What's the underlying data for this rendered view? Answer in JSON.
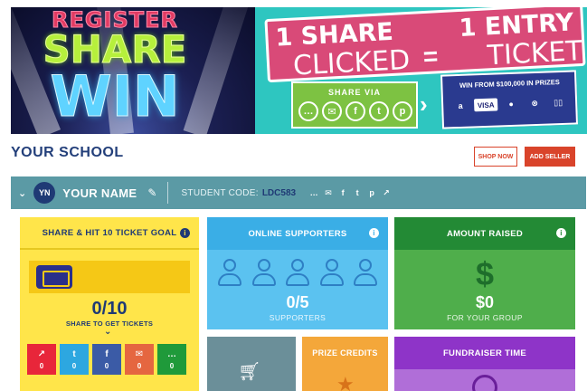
{
  "banner": {
    "register": "REGISTER",
    "share": "SHARE",
    "win": "WIN",
    "ticket_line1_left": "1 SHARE",
    "ticket_line1_right": "1 ENTRY",
    "ticket_line2_left": "CLICKED",
    "ticket_line2_right": "TICKET",
    "equals": "=",
    "share_via": "SHARE VIA",
    "share_via_icons": [
      "chat-icon",
      "email-icon",
      "facebook-icon",
      "twitter-icon",
      "pinterest-icon"
    ],
    "prizes_label": "WIN FROM $100,000 IN PRIZES",
    "prize_icons": [
      "amazon-icon",
      "visa-icon",
      "apple-icon",
      "xbox-icon",
      "nintendo-switch-icon"
    ],
    "visa_text": "VISA",
    "amazon_text": "a"
  },
  "school": {
    "title": "YOUR SCHOOL",
    "shop_now": "SHOP NOW",
    "add_seller": "ADD SELLER"
  },
  "student": {
    "initials": "YN",
    "name": "YOUR NAME",
    "code_label": "STUDENT CODE:",
    "code": "LDC583",
    "share_icons": [
      "chat-icon",
      "email-icon",
      "facebook-icon",
      "twitter-icon",
      "pinterest-icon",
      "external-link-icon"
    ]
  },
  "cards": {
    "goal": {
      "title": "SHARE & HIT 10 TICKET GOAL",
      "count": "0/10",
      "sub": "SHARE TO GET TICKETS",
      "buttons": [
        {
          "icon": "external-link-icon",
          "glyph": "↗",
          "count": "0",
          "color": "#e8263a"
        },
        {
          "icon": "twitter-icon",
          "glyph": "t",
          "count": "0",
          "color": "#2da7e0"
        },
        {
          "icon": "facebook-icon",
          "glyph": "f",
          "count": "0",
          "color": "#3b5ba6"
        },
        {
          "icon": "email-icon",
          "glyph": "✉",
          "count": "0",
          "color": "#e56640"
        },
        {
          "icon": "chat-icon",
          "glyph": "…",
          "count": "0",
          "color": "#1f9a3a"
        }
      ]
    },
    "online": {
      "title": "ONLINE SUPPORTERS",
      "count": "0/5",
      "sub": "SUPPORTERS"
    },
    "amount": {
      "title": "AMOUNT RAISED",
      "value": "$0",
      "sub": "FOR YOUR GROUP"
    },
    "prize": {
      "title": "PRIZE CREDITS"
    },
    "time": {
      "title": "FUNDRAISER TIME"
    }
  },
  "colors": {
    "navy": "#1f3a75",
    "accent_red": "#d9442b",
    "student_bar": "#5b9aa5",
    "goal_yellow": "#ffe54a",
    "online_blue": "#3aaee6",
    "amount_green": "#238a35",
    "prize_orange": "#f4a73a",
    "time_purple": "#8e34c8"
  }
}
